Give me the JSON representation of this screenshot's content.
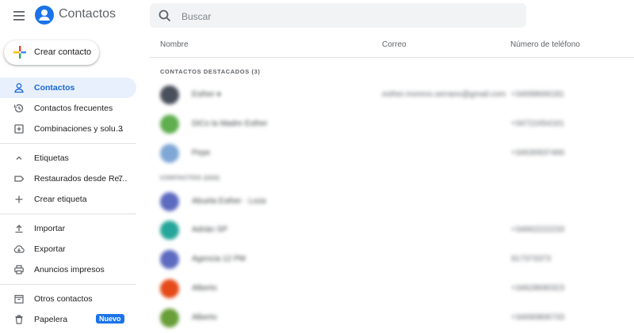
{
  "app": {
    "title": "Contactos"
  },
  "search": {
    "placeholder": "Buscar"
  },
  "create_button": {
    "label": "Crear contacto"
  },
  "sidebar": {
    "groups": [
      [
        {
          "label": "Contactos",
          "icon": "person-icon",
          "active": true
        },
        {
          "label": "Contactos frecuentes",
          "icon": "history-icon"
        },
        {
          "label": "Combinaciones y solu…",
          "icon": "merge-icon",
          "count": "3"
        }
      ],
      [
        {
          "label": "Etiquetas",
          "icon": "chevron-up-icon"
        },
        {
          "label": "Restaurados desde Re…",
          "icon": "label-icon",
          "count": "7"
        },
        {
          "label": "Crear etiqueta",
          "icon": "plus-icon"
        }
      ],
      [
        {
          "label": "Importar",
          "icon": "upload-icon"
        },
        {
          "label": "Exportar",
          "icon": "cloud-download-icon"
        },
        {
          "label": "Anuncios impresos",
          "icon": "print-icon"
        }
      ],
      [
        {
          "label": "Otros contactos",
          "icon": "archive-icon"
        },
        {
          "label": "Papelera",
          "icon": "trash-icon",
          "badge": "Nuevo"
        }
      ]
    ]
  },
  "table": {
    "headers": {
      "name": "Nombre",
      "email": "Correo",
      "phone": "Número de teléfono"
    },
    "starred_label": "CONTACTOS DESTACADOS (3)",
    "contacts_label": "CONTACTOS (222)",
    "starred": [
      {
        "name": "Esther ♦",
        "email": "esther.moreno.serrano@gmail.com",
        "phone": "+34698666181",
        "avatar_color": "#4a4f5c"
      },
      {
        "name": "DiCo la Madre Esther",
        "email": "",
        "phone": "+34722454161",
        "avatar_color": "#5fae4f"
      },
      {
        "name": "Pepe",
        "email": "",
        "phone": "+34630937466",
        "avatar_color": "#7fa7d6"
      }
    ],
    "contacts": [
      {
        "name": "Abuela Esther · Loza",
        "email": "",
        "phone": "",
        "avatar_color": "#5c6bc0"
      },
      {
        "name": "Adrián SP",
        "email": "",
        "phone": "+34662222233",
        "avatar_color": "#26a69a"
      },
      {
        "name": "Agencia 12 PM",
        "email": "",
        "phone": "917373373",
        "avatar_color": "#5c6bc0"
      },
      {
        "name": "Alberto",
        "email": "",
        "phone": "+34628690323",
        "avatar_color": "#e64a19"
      },
      {
        "name": "Alberto",
        "email": "",
        "phone": "+34690806733",
        "avatar_color": "#689f38"
      }
    ]
  }
}
